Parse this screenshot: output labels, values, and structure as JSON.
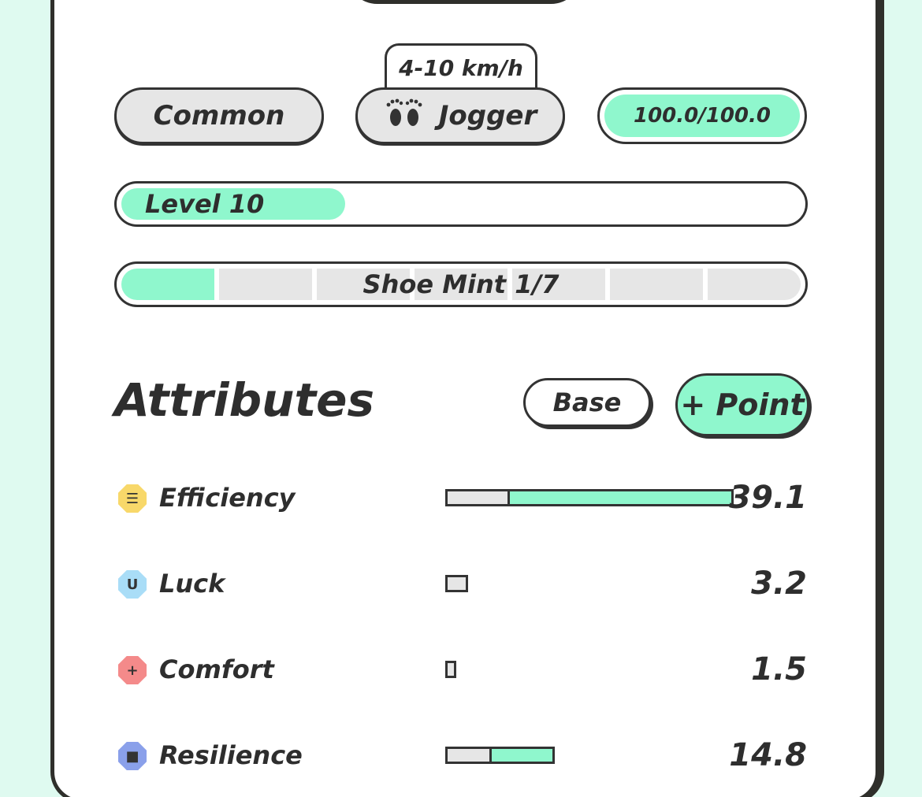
{
  "badges": {
    "rarity": "Common",
    "type_label": "Jogger",
    "speed_range": "4-10 km/h",
    "durability": "100.0/100.0"
  },
  "level": {
    "label": "Level 10",
    "fraction": 0.33
  },
  "mint": {
    "label": "Shoe Mint 1/7",
    "filled": 1,
    "total": 7
  },
  "attributes": {
    "title": "Attributes",
    "base_button": "Base",
    "point_button": "+ Point",
    "items": [
      {
        "name": "Efficiency",
        "value": "39.1",
        "icon": "efficiency-icon",
        "icon_color": "#f8d86a",
        "bar_fraction": 1.0,
        "base_fraction": 0.21
      },
      {
        "name": "Luck",
        "value": "3.2",
        "icon": "luck-icon",
        "icon_color": "#a9ddf7",
        "bar_fraction": 0.08,
        "base_fraction": 1.0
      },
      {
        "name": "Comfort",
        "value": "1.5",
        "icon": "comfort-icon",
        "icon_color": "#f48a8a",
        "bar_fraction": 0.035,
        "base_fraction": 1.0
      },
      {
        "name": "Resilience",
        "value": "14.8",
        "icon": "resilience-icon",
        "icon_color": "#8aa0ea",
        "bar_fraction": 0.38,
        "base_fraction": 0.4
      }
    ]
  },
  "colors": {
    "accent": "#8ff7cd",
    "background": "#dffaf0",
    "outline": "#2f2f2b"
  }
}
